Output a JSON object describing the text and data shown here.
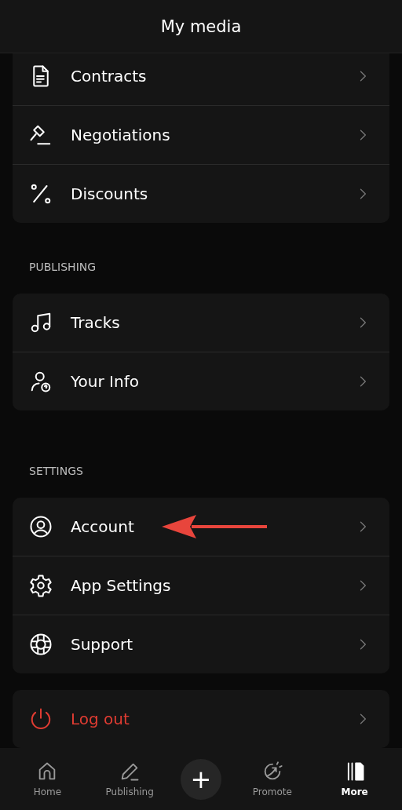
{
  "header": {
    "title": "My media"
  },
  "sections": [
    {
      "items": [
        {
          "label": "Contracts",
          "kind": "normal"
        },
        {
          "label": "Negotiations",
          "kind": "normal"
        },
        {
          "label": "Discounts",
          "kind": "normal"
        }
      ]
    },
    {
      "title": "PUBLISHING",
      "items": [
        {
          "label": "Tracks",
          "kind": "normal"
        },
        {
          "label": "Your Info",
          "kind": "normal"
        }
      ]
    },
    {
      "title": "SETTINGS",
      "items": [
        {
          "label": "Account",
          "kind": "normal"
        },
        {
          "label": "App Settings",
          "kind": "normal"
        },
        {
          "label": "Support",
          "kind": "normal"
        }
      ]
    },
    {
      "items": [
        {
          "label": "Log out",
          "kind": "danger"
        }
      ]
    }
  ],
  "annotation": {
    "kind": "arrow",
    "color": "#e8453c"
  },
  "nav": [
    {
      "label": "Home",
      "selected": false
    },
    {
      "label": "Publishing",
      "selected": false
    },
    {
      "kind": "add",
      "label": "+"
    },
    {
      "label": "Promote",
      "selected": false
    },
    {
      "label": "More",
      "selected": true
    }
  ]
}
